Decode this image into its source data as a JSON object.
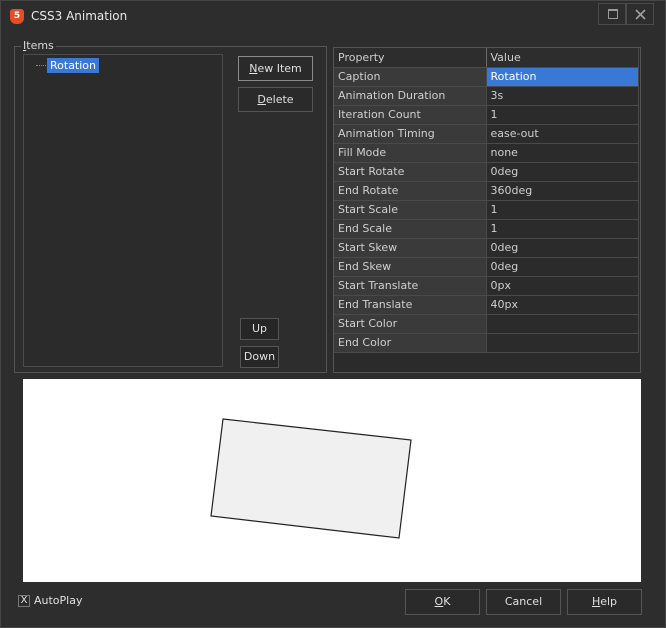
{
  "window": {
    "title": "CSS3 Animation",
    "icon_label": "5"
  },
  "items_group": {
    "label_accel": "I",
    "label_rest": "tems",
    "tree_items": [
      "Rotation"
    ]
  },
  "buttons": {
    "new_item_accel": "N",
    "new_item_rest": "ew Item",
    "delete_accel": "D",
    "delete_rest": "elete",
    "up": "Up",
    "down": "Down",
    "ok_accel": "O",
    "ok_rest": "K",
    "cancel": "Cancel",
    "help_accel": "H",
    "help_rest": "elp"
  },
  "property_grid": {
    "header": {
      "property": "Property",
      "value": "Value"
    },
    "rows": [
      {
        "property": "Caption",
        "value": "Rotation"
      },
      {
        "property": "Animation Duration",
        "value": "3s"
      },
      {
        "property": "Iteration Count",
        "value": "1"
      },
      {
        "property": "Animation Timing",
        "value": "ease-out"
      },
      {
        "property": "Fill Mode",
        "value": "none"
      },
      {
        "property": "Start Rotate",
        "value": "0deg"
      },
      {
        "property": "End Rotate",
        "value": "360deg"
      },
      {
        "property": "Start Scale",
        "value": "1"
      },
      {
        "property": "End Scale",
        "value": "1"
      },
      {
        "property": "Start Skew",
        "value": "0deg"
      },
      {
        "property": "End Skew",
        "value": "0deg"
      },
      {
        "property": "Start Translate",
        "value": "0px"
      },
      {
        "property": "End Translate",
        "value": "40px"
      },
      {
        "property": "Start Color",
        "value": ""
      },
      {
        "property": "End Color",
        "value": ""
      }
    ]
  },
  "autoplay": {
    "label": "AutoPlay",
    "checked_mark": "X"
  },
  "colors": {
    "selection": "#3a78d6",
    "preview_background": "#ffffff",
    "preview_shape_fill": "#f0f0f0"
  }
}
